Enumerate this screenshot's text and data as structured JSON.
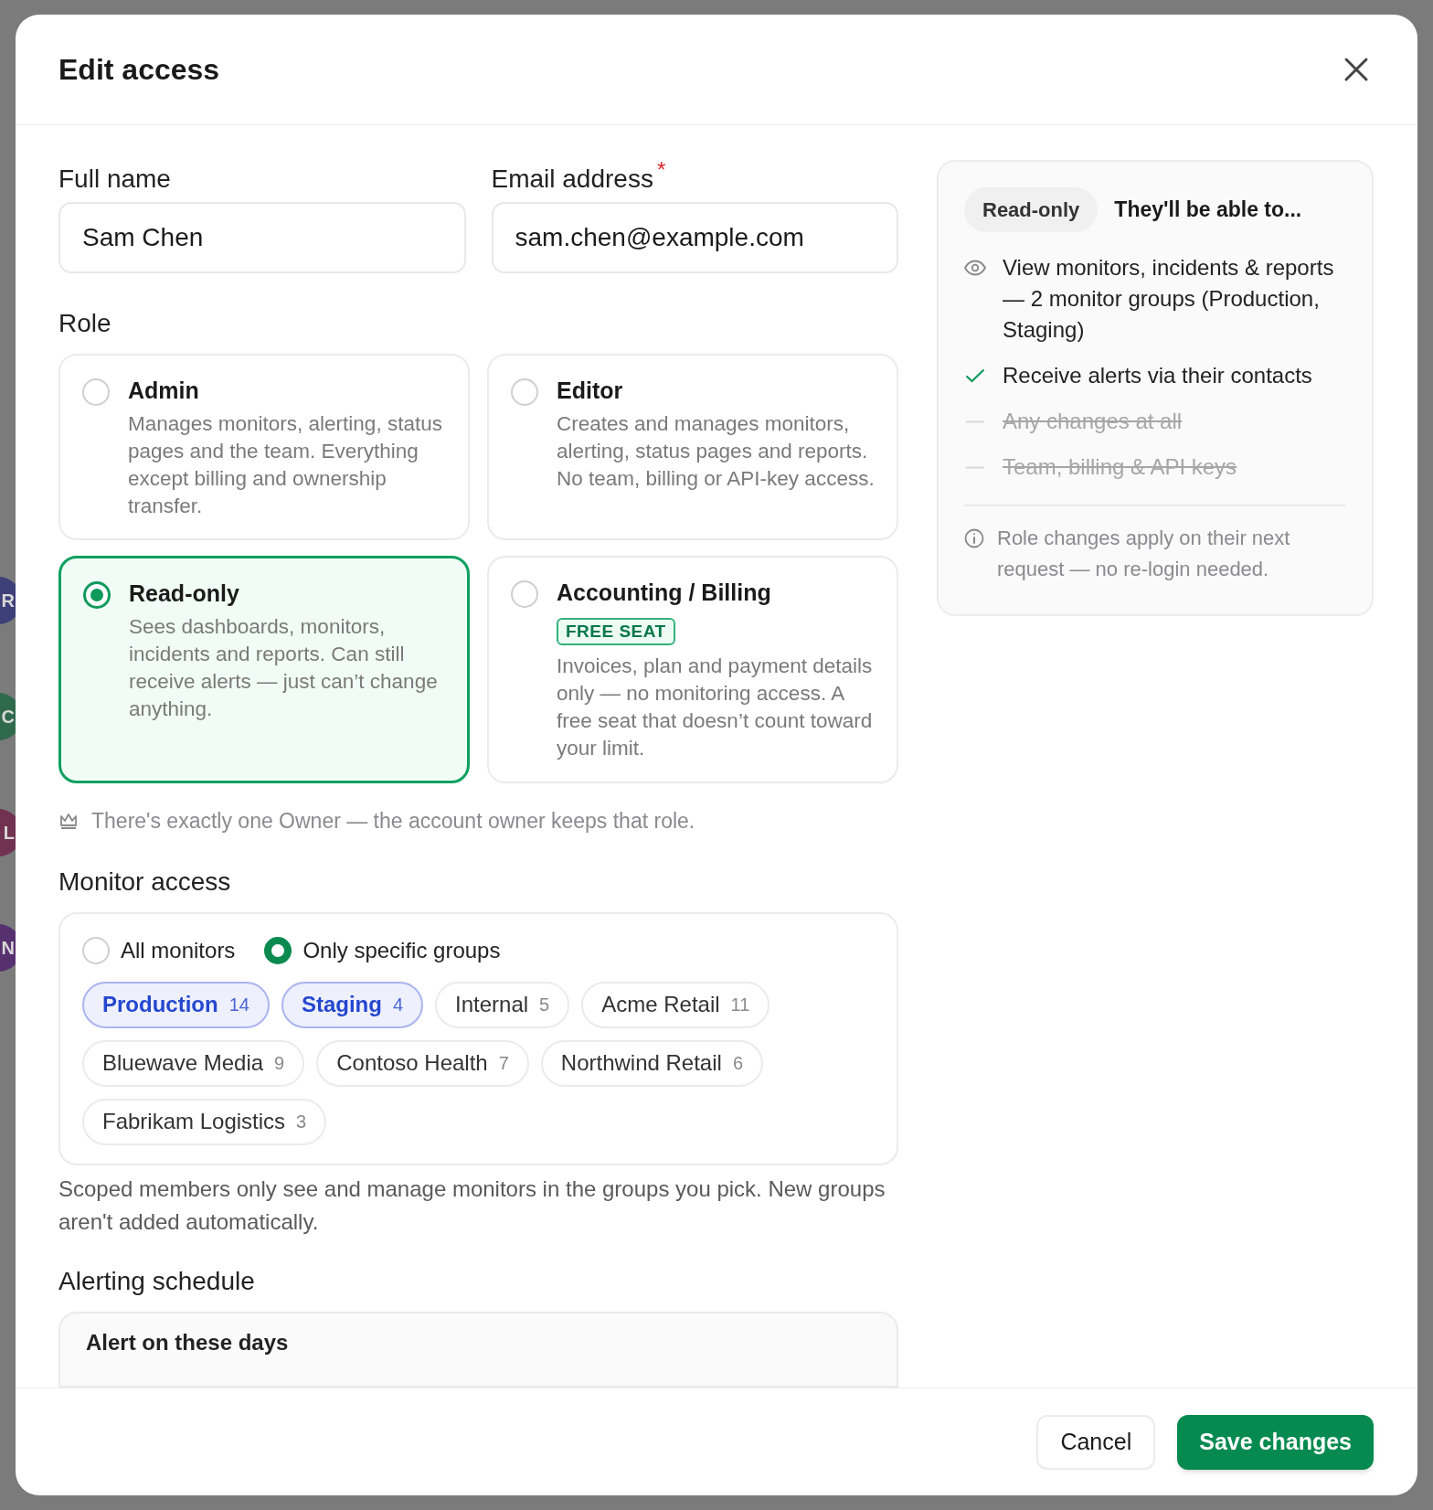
{
  "background": {
    "avatars": [
      {
        "letter": "R",
        "color": "#3d3f78"
      },
      {
        "letter": "C",
        "color": "#2f6a4c"
      },
      {
        "letter": "L",
        "color": "#713150"
      },
      {
        "letter": "N",
        "color": "#573070"
      }
    ]
  },
  "dialog": {
    "title": "Edit access"
  },
  "fields": [
    {
      "label": "Full name",
      "value": "Sam Chen"
    },
    {
      "label": "Email address",
      "required_mark": "*",
      "value": "sam.chen@example.com"
    }
  ],
  "role": {
    "label": "Role",
    "options": [
      {
        "title": "Admin",
        "description": "Manages monitors, alerting, status pages and the team. Everything except billing and ownership transfer.",
        "selected": false
      },
      {
        "title": "Editor",
        "description": "Creates and manages monitors, alerting, status pages and reports. No team, billing or API-key access.",
        "selected": false
      },
      {
        "title": "Read-only",
        "description": "Sees dashboards, monitors, incidents and reports. Can still receive alerts — just can’t change anything.",
        "selected": true
      },
      {
        "title": "Accounting / Billing",
        "badge": "FREE SEAT",
        "description": "Invoices, plan and payment details only — no monitoring access. A free seat that doesn’t count toward your limit.",
        "selected": false
      }
    ],
    "note": "There's exactly one Owner — the account owner keeps that role."
  },
  "monitor_access": {
    "label": "Monitor access",
    "scopes": [
      {
        "label": "All monitors",
        "selected": false
      },
      {
        "label": "Only specific groups",
        "selected": true
      }
    ],
    "groups": [
      {
        "name": "Production",
        "count": "14",
        "selected": true
      },
      {
        "name": "Staging",
        "count": "4",
        "selected": true
      },
      {
        "name": "Internal",
        "count": "5",
        "selected": false
      },
      {
        "name": "Acme Retail",
        "count": "11",
        "selected": false
      },
      {
        "name": "Bluewave Media",
        "count": "9",
        "selected": false
      },
      {
        "name": "Contoso Health",
        "count": "7",
        "selected": false
      },
      {
        "name": "Northwind Retail",
        "count": "6",
        "selected": false
      },
      {
        "name": "Fabrikam Logistics",
        "count": "3",
        "selected": false
      }
    ],
    "help": "Scoped members only see and manage monitors in the groups you pick. New groups aren't added automatically."
  },
  "alerting_schedule": {
    "label": "Alerting schedule",
    "subheading": "Alert on these days"
  },
  "summary": {
    "role_badge": "Read-only",
    "heading": "They'll be able to...",
    "items": [
      {
        "kind": "view",
        "text": "View monitors, incidents & reports — 2 monitor groups (Production, Staging)",
        "allowed": true
      },
      {
        "kind": "check",
        "text": "Receive alerts via their contacts",
        "allowed": true
      },
      {
        "kind": "dash",
        "text": "Any changes at all",
        "allowed": false
      },
      {
        "kind": "dash",
        "text": "Team, billing & API keys",
        "allowed": false
      }
    ],
    "note": "Role changes apply on their next request — no re-login needed."
  },
  "footer": {
    "buttons": [
      {
        "label": "Cancel",
        "kind": "secondary"
      },
      {
        "label": "Save changes",
        "kind": "primary"
      }
    ]
  }
}
